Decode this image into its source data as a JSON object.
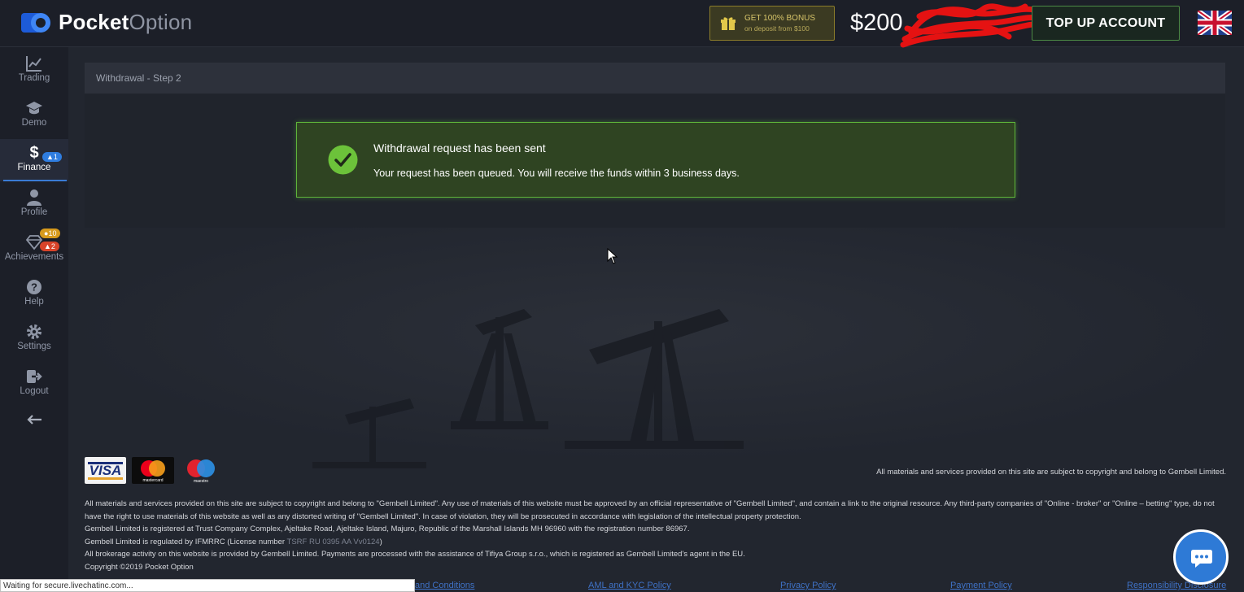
{
  "header": {
    "logo_bold": "Pocket",
    "logo_light": "Option",
    "bonus_line1": "GET 100% BONUS",
    "bonus_line2": "on deposit from $100",
    "balance": "$200",
    "topup_label": "TOP UP ACCOUNT"
  },
  "sidebar": {
    "items": [
      {
        "label": "Trading",
        "icon": "chart-icon"
      },
      {
        "label": "Demo",
        "icon": "graduation-cap-icon"
      },
      {
        "label": "Finance",
        "icon": "dollar-icon",
        "badge": "1"
      },
      {
        "label": "Profile",
        "icon": "user-icon"
      },
      {
        "label": "Achievements",
        "icon": "diamond-icon",
        "badge_top": "10",
        "badge_bottom": "2"
      },
      {
        "label": "Help",
        "icon": "question-icon"
      },
      {
        "label": "Settings",
        "icon": "gear-icon"
      },
      {
        "label": "Logout",
        "icon": "logout-icon"
      }
    ],
    "collapse_icon": "arrow-left-icon"
  },
  "main": {
    "step_title": "Withdrawal - Step 2",
    "success_title": "Withdrawal request has been sent",
    "success_message": "Your request has been queued. You will receive the funds within 3 business days."
  },
  "footer": {
    "visa": "VISA",
    "mastercard": "mastercard",
    "maestro": "maestro",
    "copyright_right": "All materials and services provided on this site are subject to copyright and belong to Gembell Limited.",
    "legal_1": "All materials and services provided on this site are subject to copyright and belong to \"Gembell Limited\". Any use of materials of this website must be approved by an official representative of \"Gembell Limited\", and contain a link to the original resource. Any third-party companies of \"Online - broker\" or \"Online – betting\" type, do not have the right to use materials of this website as well as any distorted writing of \"Gembell Limited\". In case of violation, they will be prosecuted in accordance with legislation of the intellectual property protection.",
    "legal_2": "Gembell Limited is registered at Trust Company Complex, Ajeltake Road, Ajeltake Island, Majuro, Republic of the Marshall Islands MH 96960 with the registration number 86967.",
    "legal_3a": "Gembell Limited is regulated by IFMRRC (License number ",
    "legal_3_license": "TSRF RU 0395 AA Vv0124",
    "legal_3b": ")",
    "legal_4": "All brokerage activity on this website is provided by Gembell Limited. Payments are processed with the assistance of Tifiya Group s.r.o., which is registered as Gembell Limited's agent in the EU.",
    "legal_5": "Copyright ©2019 Pocket Option",
    "links": [
      "and Conditions",
      "AML and KYC Policy",
      "Privacy Policy",
      "Payment Policy",
      "Responsibility Disclosure"
    ]
  },
  "statusbar": "Waiting for secure.livechatinc.com...",
  "colors": {
    "background": "#22262f",
    "accent_green": "#5fb63a",
    "link_blue": "#3f72c7",
    "chat_blue": "#2e7ad6"
  }
}
